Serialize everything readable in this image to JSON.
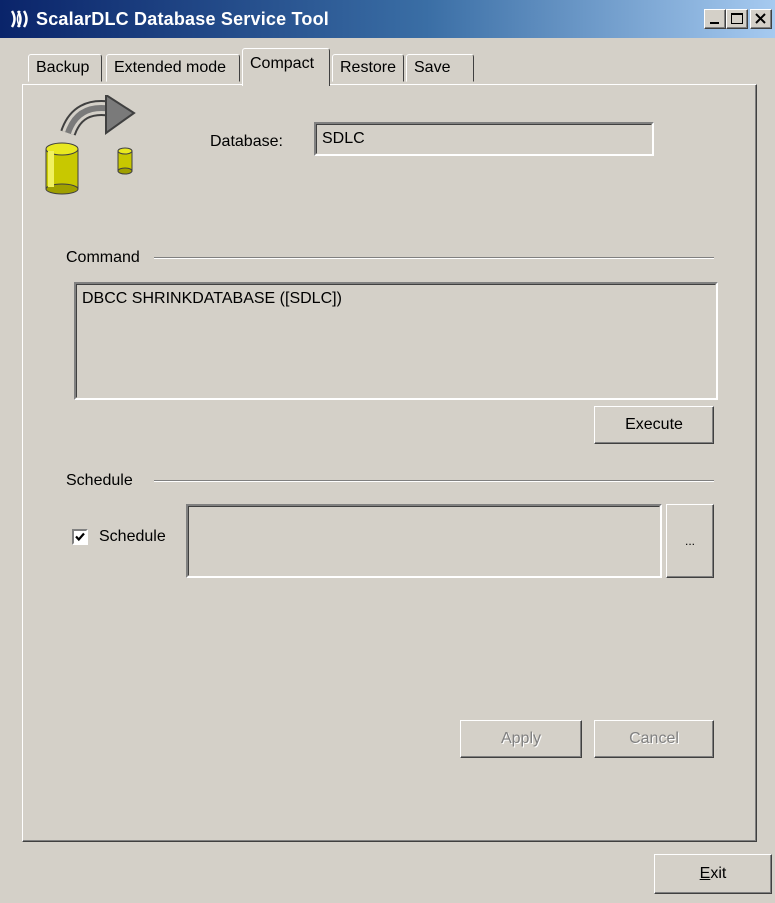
{
  "window": {
    "title": "ScalarDLC Database Service Tool"
  },
  "icons": {
    "app": "app-logo-icon",
    "minimize": "minimize-icon",
    "maximize": "maximize-icon",
    "close": "close-icon",
    "database": "database-transfer-icon"
  },
  "tabs": [
    {
      "label": "Backup"
    },
    {
      "label": "Extended mode"
    },
    {
      "label": "Compact",
      "active": true
    },
    {
      "label": "Restore"
    },
    {
      "label": "Save"
    }
  ],
  "compact": {
    "database_label": "Database:",
    "database_value": "SDLC",
    "command_group": "Command",
    "command_text": "DBCC SHRINKDATABASE ([SDLC])",
    "execute_label": "Execute",
    "schedule_group": "Schedule",
    "schedule_checkbox_label": "Schedule",
    "schedule_checked": true,
    "schedule_value": "",
    "browse_label": "...",
    "apply_label": "Apply",
    "cancel_label": "Cancel"
  },
  "footer": {
    "exit_label": "Exit",
    "exit_mnemonic": "E",
    "exit_rest": "xit"
  }
}
